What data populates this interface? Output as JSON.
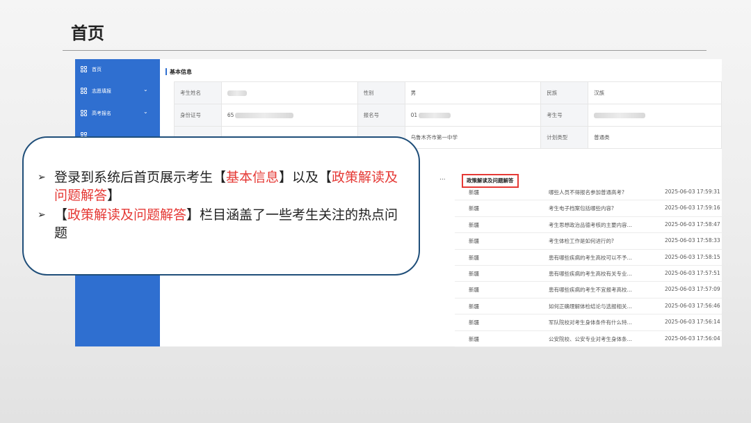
{
  "slide": {
    "title": "首页"
  },
  "sidebar": {
    "items": [
      {
        "label": "首页",
        "has_chevron": false
      },
      {
        "label": "志愿填报",
        "has_chevron": true
      },
      {
        "label": "高考报名",
        "has_chevron": true
      },
      {
        "label": "",
        "has_chevron": true
      }
    ],
    "chevron": "⌄"
  },
  "basic_info": {
    "heading": "基本信息",
    "rows": [
      [
        "考生姓名",
        "",
        "性别",
        "男",
        "民族",
        "汉族"
      ],
      [
        "身份证号",
        "65",
        "报名号",
        "01",
        "考生号",
        ""
      ],
      [
        "",
        "",
        "",
        "乌鲁木齐市第一中学",
        "计划类型",
        "普通类"
      ]
    ]
  },
  "policy": {
    "heading": "政策解读及问题解答",
    "more": "...",
    "rows": [
      {
        "region": "新疆",
        "question": "哪些人员不得报名参加普通高考?",
        "time": "2025-06-03 17:59:31"
      },
      {
        "region": "新疆",
        "question": "考生电子档案包括哪些内容?",
        "time": "2025-06-03 17:59:16"
      },
      {
        "region": "新疆",
        "question": "考生思想政治品德考核的主要内容…",
        "time": "2025-06-03 17:58:47"
      },
      {
        "region": "新疆",
        "question": "考生体检工作是如何进行的?",
        "time": "2025-06-03 17:58:33"
      },
      {
        "region": "新疆",
        "question": "患有哪些疾病的考生高校可以不予…",
        "time": "2025-06-03 17:58:15"
      },
      {
        "region": "新疆",
        "question": "患有哪些疾病的考生高校有关专业…",
        "time": "2025-06-03 17:57:51"
      },
      {
        "region": "新疆",
        "question": "患有哪些疾病的考生不宜报考高校…",
        "time": "2025-06-03 17:57:09"
      },
      {
        "region": "新疆",
        "question": "如何正确理解体检结论与选报相关…",
        "time": "2025-06-03 17:56:46"
      },
      {
        "region": "新疆",
        "question": "军队院校对考生身体条件有什么特…",
        "time": "2025-06-03 17:56:14"
      },
      {
        "region": "新疆",
        "question": "公安院校、公安专业对考生身体条…",
        "time": "2025-06-03 17:56:04"
      }
    ]
  },
  "callout": {
    "bullet_icon": "➢",
    "b1_part1": "登录到系统后首页展示考生【",
    "b1_red1": "基本信息",
    "b1_part2": "】以及【",
    "b1_red2": "政策解读及问题解答",
    "b1_part3": "】",
    "b2_part1": "【",
    "b2_red1": "政策解读及问题解答",
    "b2_part2": "】栏目涵盖了一些考生关注的热点问题"
  },
  "colors": {
    "sidebar": "#2f6fd0",
    "highlight": "#e53935",
    "callout_border": "#1f4e79"
  }
}
